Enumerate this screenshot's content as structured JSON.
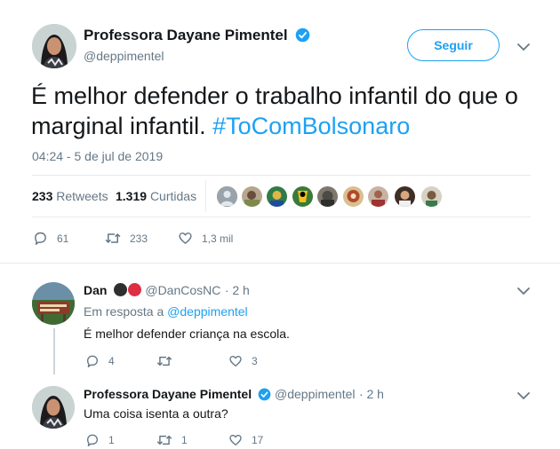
{
  "main_tweet": {
    "author_name": "Professora Dayane Pimentel",
    "author_handle": "@deppimentel",
    "follow_label": "Seguir",
    "text_before": "É melhor defender o trabalho infantil do que o marginal infantil. ",
    "hashtag": "#ToComBolsonaro",
    "timestamp": "04:24 - 5 de jul de 2019",
    "retweets_count": "233",
    "retweets_label": "Retweets",
    "likes_count": "1.319",
    "likes_label": "Curtidas",
    "reply_count": "61",
    "retweet_count": "233",
    "like_count": "1,3 mil"
  },
  "replies": [
    {
      "author_name": "Dan",
      "author_handle": "@DanCosNC",
      "time": "· 2 h",
      "in_reply_label": "Em resposta a",
      "in_reply_to": "@deppimentel",
      "text": "É melhor defender criança na escola.",
      "reply_count": "4",
      "retweet_count": "",
      "like_count": "3"
    },
    {
      "author_name": "Professora Dayane Pimentel",
      "author_handle": "@deppimentel",
      "time": "· 2 h",
      "text": "Uma coisa isenta a outra?",
      "reply_count": "1",
      "retweet_count": "1",
      "like_count": "17"
    }
  ],
  "colors": {
    "accent": "#1da1f2",
    "muted": "#657786",
    "text": "#14171a"
  }
}
